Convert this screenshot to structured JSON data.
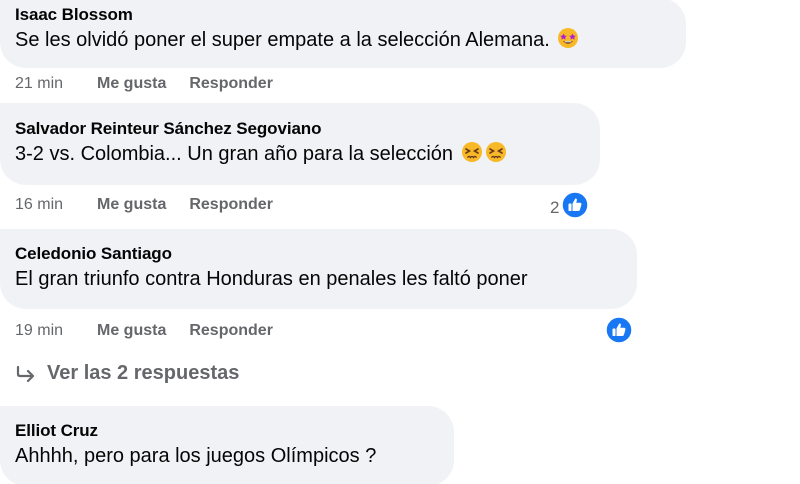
{
  "comments": [
    {
      "author": "Isaac Blossom",
      "text": "Se les olvidó poner el super empate a la selección Alemana.",
      "emoji": [
        "star-struck-emoji"
      ],
      "time": "21 min",
      "like_label": "Me gusta",
      "reply_label": "Responder"
    },
    {
      "author": "Salvador Reinteur Sánchez Segoviano",
      "text": "3-2 vs. Colombia... Un gran año para la selección",
      "emoji": [
        "persevering-face-emoji",
        "persevering-face-emoji"
      ],
      "time": "16 min",
      "like_label": "Me gusta",
      "reply_label": "Responder",
      "reaction_count": "2",
      "reaction_icon": "thumbs-up-icon"
    },
    {
      "author": "Celedonio Santiago",
      "text": "El gran triunfo contra Honduras en penales les faltó poner",
      "time": "19 min",
      "like_label": "Me gusta",
      "reply_label": "Responder",
      "reaction_icon": "thumbs-up-icon",
      "view_replies_label": "Ver las 2 respuestas",
      "view_replies_icon": "reply-arrow-icon"
    },
    {
      "author": "Elliot Cruz",
      "text": "Ahhhh, pero para los juegos Olímpicos ?"
    }
  ],
  "colors": {
    "bubble": "#f0f2f5",
    "meta": "#65676b",
    "like_blue": "#1877f2",
    "text": "#050505"
  }
}
